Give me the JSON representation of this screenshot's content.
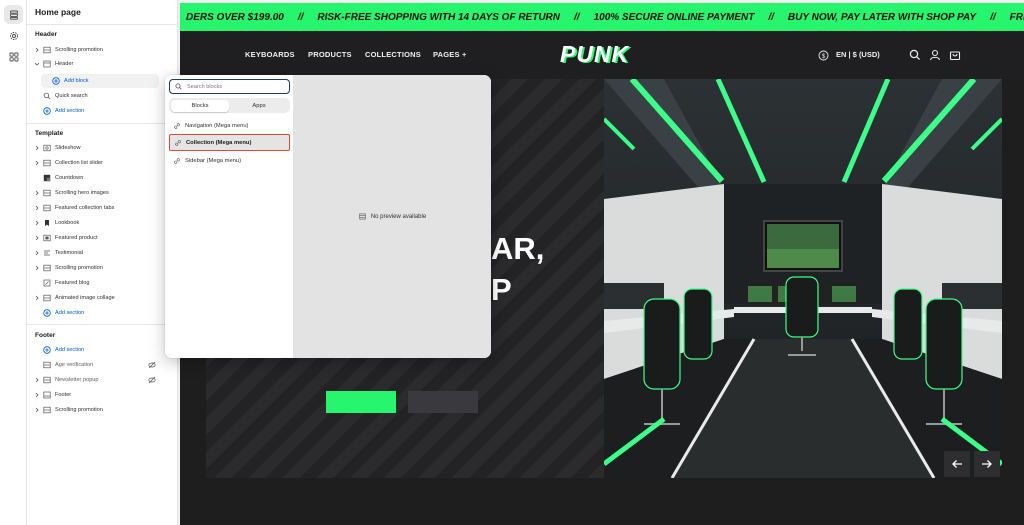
{
  "sidebar": {
    "title": "Home page",
    "header_group": "Header",
    "header_items": [
      {
        "label": "Scrolling promotion"
      },
      {
        "label": "Header"
      }
    ],
    "add_block": "Add block",
    "quick_search": "Quick search",
    "add_section_1": "Add section",
    "template_group": "Template",
    "template_items": [
      {
        "label": "Slideshow"
      },
      {
        "label": "Collection list slider"
      },
      {
        "label": "Countdown"
      },
      {
        "label": "Scrolling hero images"
      },
      {
        "label": "Featured collection tabs"
      },
      {
        "label": "Lookbook"
      },
      {
        "label": "Featured product"
      },
      {
        "label": "Testimonial"
      },
      {
        "label": "Scrolling promotion"
      },
      {
        "label": "Featured blog"
      },
      {
        "label": "Animated image collage"
      }
    ],
    "add_section_2": "Add section",
    "footer_group": "Footer",
    "add_section_3": "Add section",
    "footer_items": [
      {
        "label": "Age verification"
      },
      {
        "label": "Newsletter popup"
      },
      {
        "label": "Footer"
      },
      {
        "label": "Scrolling promotion"
      }
    ]
  },
  "popover": {
    "search_placeholder": "Search blocks",
    "tabs": [
      "Blocks",
      "Apps"
    ],
    "items": [
      {
        "label": "Navigation (Mega menu)"
      },
      {
        "label": "Collection (Mega menu)"
      },
      {
        "label": "Sidebar (Mega menu)"
      }
    ],
    "no_preview": "No preview available"
  },
  "store": {
    "marquee": [
      "DERS OVER $199.00",
      "RISK-FREE SHOPPING WITH 14 DAYS OF RETURN",
      "100% SECURE ONLINE PAYMENT",
      "BUY NOW, PAY LATER WITH SHOP PAY",
      "FREE SHIPP"
    ],
    "marquee_sep": "//",
    "nav": [
      "KEYBOARDS",
      "PRODUCTS",
      "COLLECTIONS",
      "PAGES"
    ],
    "nav_plus": "+",
    "logo": "PUNK",
    "locale": "EN | $ (USD)",
    "hero_line1": "AR,",
    "hero_line2": "P"
  },
  "colors": {
    "accent_green": "#27f56e",
    "link_blue": "#005bd3",
    "selection_red": "#e0463a"
  }
}
